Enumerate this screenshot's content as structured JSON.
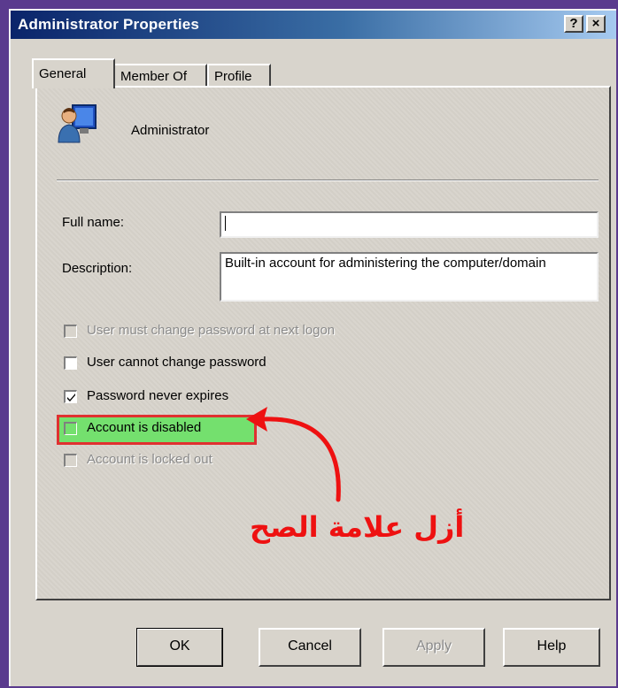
{
  "window": {
    "title": "Administrator Properties",
    "help_button": "?",
    "close_button": "×"
  },
  "tabs": [
    {
      "label": "General",
      "active": true
    },
    {
      "label": "Member Of",
      "active": false
    },
    {
      "label": "Profile",
      "active": false
    }
  ],
  "general": {
    "user_icon": "user-monitor-icon",
    "user_name": "Administrator",
    "full_name_label": "Full name:",
    "full_name_value": "",
    "description_label": "Description:",
    "description_value": "Built-in account for administering the computer/domain",
    "checkboxes": [
      {
        "label": "User must change password at next logon",
        "checked": false,
        "enabled": false
      },
      {
        "label": "User cannot change password",
        "checked": false,
        "enabled": true
      },
      {
        "label": "Password never expires",
        "checked": true,
        "enabled": true
      },
      {
        "label": "Account is disabled",
        "checked": false,
        "enabled": true,
        "highlighted": true
      },
      {
        "label": "Account is locked out",
        "checked": false,
        "enabled": false
      }
    ]
  },
  "annotation": {
    "text": "أزل علامة الصح",
    "color": "#ee1111",
    "highlight_color": "#74e06e"
  },
  "buttons": {
    "ok": "OK",
    "cancel": "Cancel",
    "apply": "Apply",
    "help": "Help"
  }
}
